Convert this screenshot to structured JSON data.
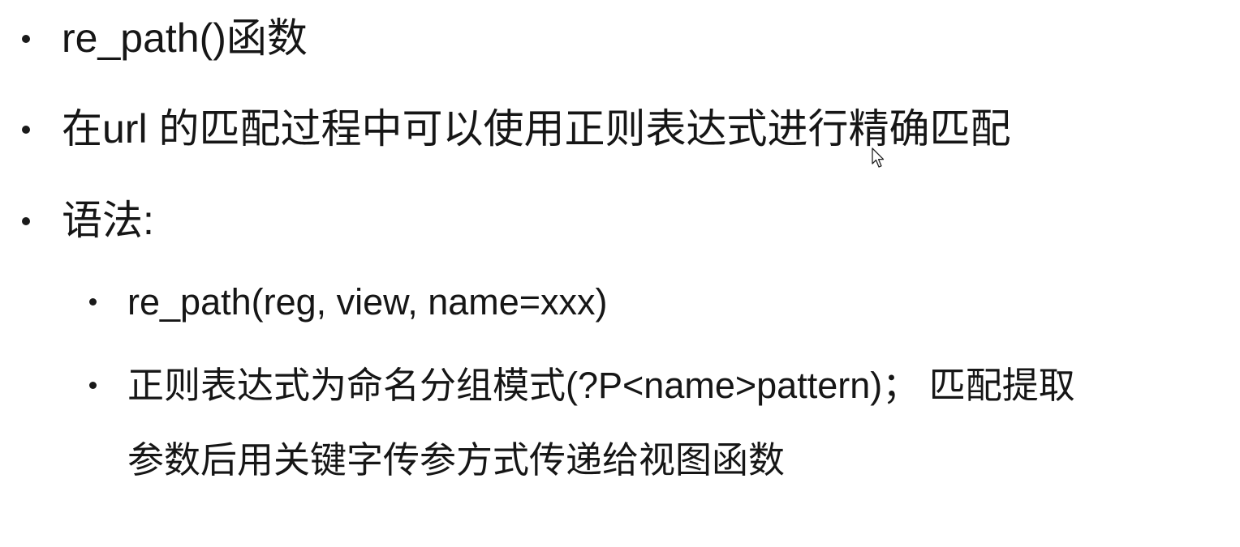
{
  "slide": {
    "bullets": [
      {
        "text": "re_path()函数"
      },
      {
        "text": "在url 的匹配过程中可以使用正则表达式进行精确匹配"
      },
      {
        "text": "语法:",
        "sub_bullets": [
          {
            "text": "re_path(reg, view, name=xxx)"
          },
          {
            "line1": "正则表达式为命名分组模式(?P<name>pattern)；  匹配提取",
            "line2": "参数后用关键字传参方式传递给视图函数"
          }
        ]
      }
    ]
  },
  "cursor": {
    "icon": "mouse-pointer-icon"
  }
}
